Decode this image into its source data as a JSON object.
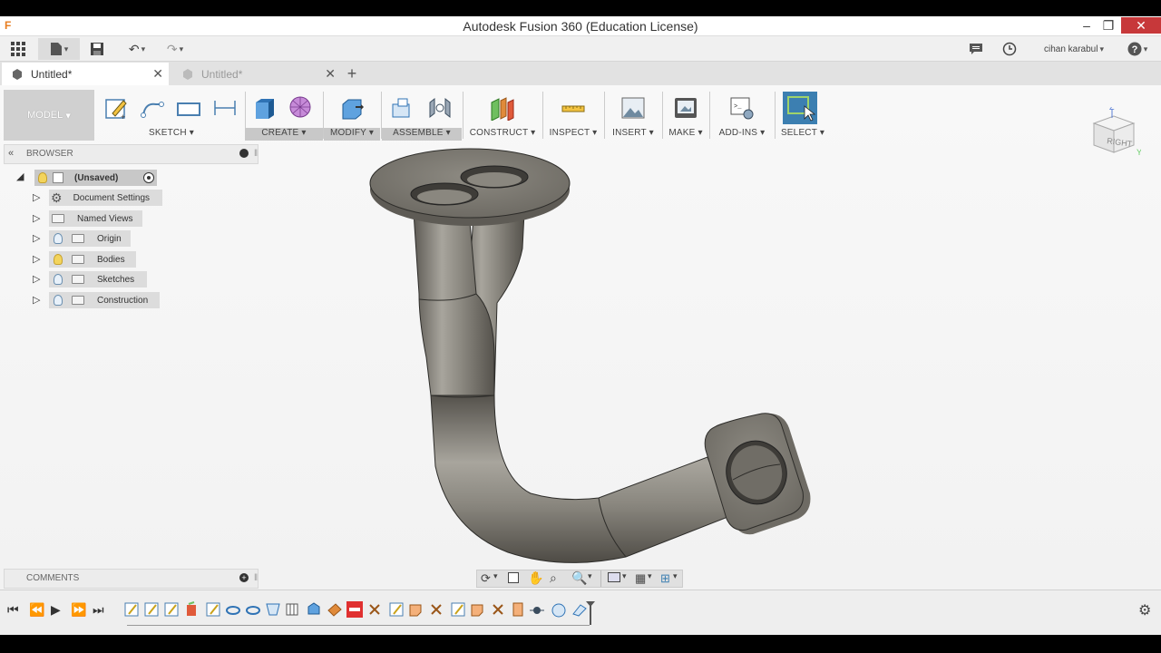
{
  "window": {
    "title": "Autodesk Fusion 360 (Education License)",
    "app_icon": "F"
  },
  "qat": {
    "user_name": "cihan karabul"
  },
  "tabs": [
    {
      "label": "Untitled*",
      "active": true
    },
    {
      "label": "Untitled*",
      "active": false
    }
  ],
  "toolbar": {
    "workspace": "MODEL",
    "groups": [
      "SKETCH",
      "CREATE",
      "MODIFY",
      "ASSEMBLE",
      "CONSTRUCT",
      "INSPECT",
      "INSERT",
      "MAKE",
      "ADD-INS",
      "SELECT"
    ]
  },
  "browser": {
    "title": "BROWSER",
    "root": "(Unsaved)",
    "items": [
      {
        "label": "Document Settings",
        "icon": "gear-icon"
      },
      {
        "label": "Named Views",
        "icon": "folder-icon"
      },
      {
        "label": "Origin",
        "icon": "folder-icon",
        "bulb": "off"
      },
      {
        "label": "Bodies",
        "icon": "folder-icon",
        "bulb": "on"
      },
      {
        "label": "Sketches",
        "icon": "folder-icon",
        "bulb": "off"
      },
      {
        "label": "Construction",
        "icon": "folder-icon",
        "bulb": "off"
      }
    ]
  },
  "comments": {
    "title": "COMMENTS"
  },
  "viewcube": {
    "face": "RIGHT",
    "axes": {
      "z": "Z",
      "x": "X",
      "y": "Y"
    }
  },
  "colors": {
    "accent": "#3c7fb1",
    "close": "#c7383a",
    "part": "#7d7a72"
  }
}
